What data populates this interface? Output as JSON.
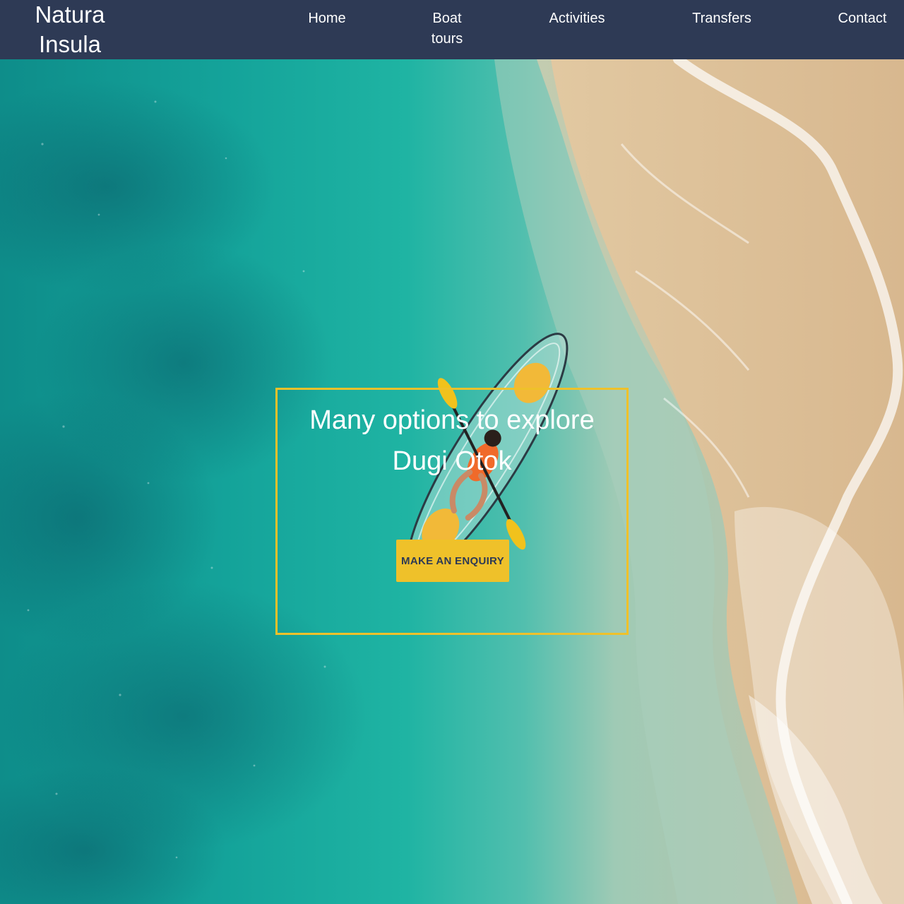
{
  "header": {
    "brand_line1": "Natura",
    "brand_line2": "Insula",
    "nav": {
      "home": "Home",
      "boat_line1": "Boat",
      "boat_line2": "tours",
      "activities": "Activities",
      "transfers": "Transfers",
      "contact": "Contact"
    }
  },
  "hero": {
    "title_line1": "Many options to explore",
    "title_line2": "Dugi Otok",
    "cta_label": "MAKE AN ENQUIRY",
    "background_image": "aerial-beach-kayak-photo"
  },
  "colors": {
    "header_bg": "#2e3a55",
    "accent": "#efc12a",
    "text_light": "#ffffff",
    "button_text": "#2e3a55"
  }
}
